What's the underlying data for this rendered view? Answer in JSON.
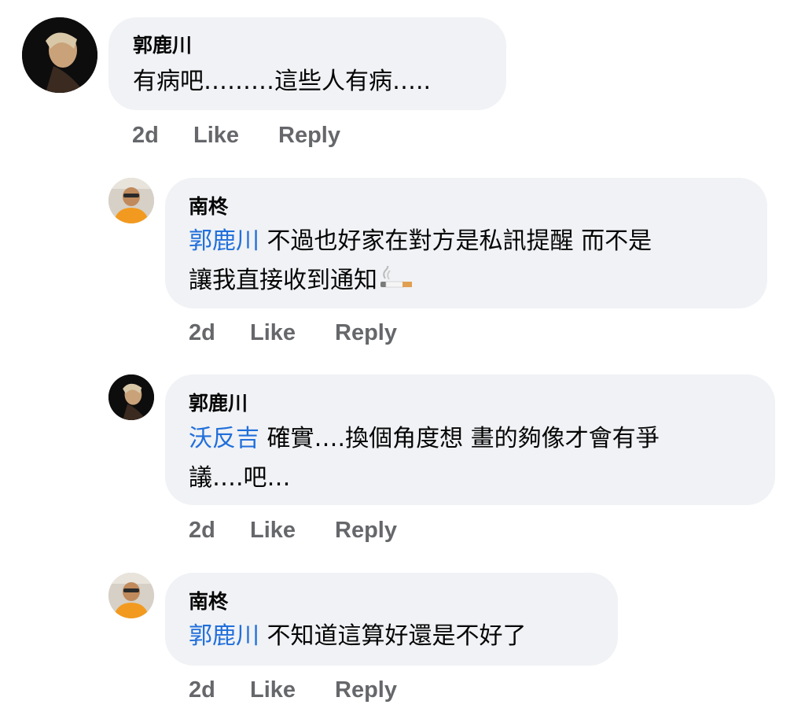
{
  "comments": [
    {
      "author": "郭鹿川",
      "mention": "",
      "text": "有病吧………這些人有病…..",
      "time": "2d",
      "like": "Like",
      "reply": "Reply"
    },
    {
      "author": "南柊",
      "mention": "郭鹿川",
      "text_line1": "不過也好家在對方是私訊提醒 而不是",
      "text_line2": "讓我直接收到通知",
      "emoji": "cigarette",
      "time": "2d",
      "like": "Like",
      "reply": "Reply"
    },
    {
      "author": "郭鹿川",
      "mention": "沃反吉",
      "text_line1": "確實….換個角度想 畫的夠像才會有爭",
      "text_line2": "議….吧…",
      "time": "2d",
      "like": "Like",
      "reply": "Reply"
    },
    {
      "author": "南柊",
      "mention": "郭鹿川",
      "text": "不知道這算好還是不好了",
      "time": "2d",
      "like": "Like",
      "reply": "Reply"
    }
  ],
  "colors": {
    "bubble": "#f0f2f5",
    "mention": "#216fdb",
    "meta": "#65676b"
  }
}
